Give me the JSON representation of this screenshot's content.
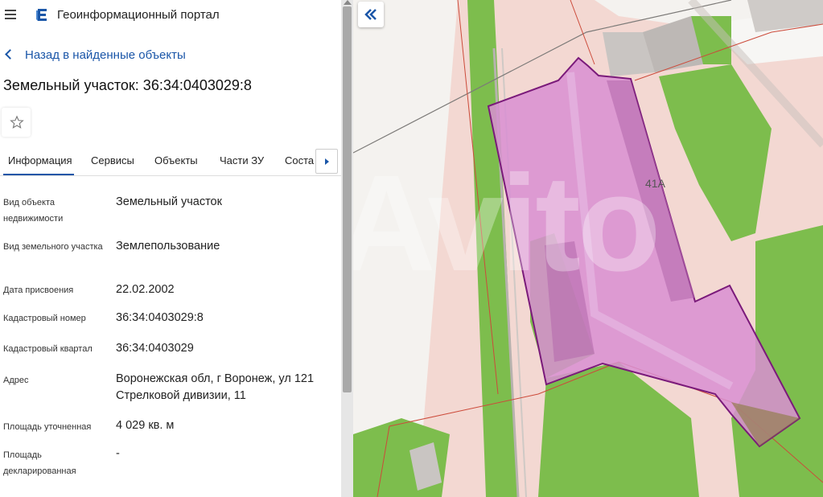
{
  "header": {
    "portal_title": "Геоинформационный портал"
  },
  "nav": {
    "back_label": "Назад в найденные объекты"
  },
  "object": {
    "title": "Земельный участок: 36:34:0403029:8"
  },
  "tabs": [
    {
      "label": "Информация"
    },
    {
      "label": "Сервисы"
    },
    {
      "label": "Объекты"
    },
    {
      "label": "Части ЗУ"
    },
    {
      "label": "Соста"
    }
  ],
  "fields": [
    {
      "label": "Вид объекта недвижимости",
      "value": "Земельный участок"
    },
    {
      "label": "Вид земельного участка",
      "value": "Землепользование"
    },
    {
      "label": "Дата присвоения",
      "value": "22.02.2002"
    },
    {
      "label": "Кадастровый номер",
      "value": "36:34:0403029:8"
    },
    {
      "label": "Кадастровый квартал",
      "value": "36:34:0403029"
    },
    {
      "label": "Адрес",
      "value": "Воронежская обл, г Воронеж, ул 121 Стрелковой дивизии, 11"
    },
    {
      "label": "Площадь уточненная",
      "value": "4 029 кв. м"
    },
    {
      "label": "Площадь декларированная",
      "value": "-"
    }
  ],
  "map": {
    "parcel_label": "41А",
    "watermark": "Avito"
  },
  "colors": {
    "accent": "#1a56a8",
    "parcel_fill": "#d98fd3",
    "parcel_stroke": "#7a1a7a",
    "green": "#7fbf4f",
    "background_pink": "#f3d8d2"
  }
}
